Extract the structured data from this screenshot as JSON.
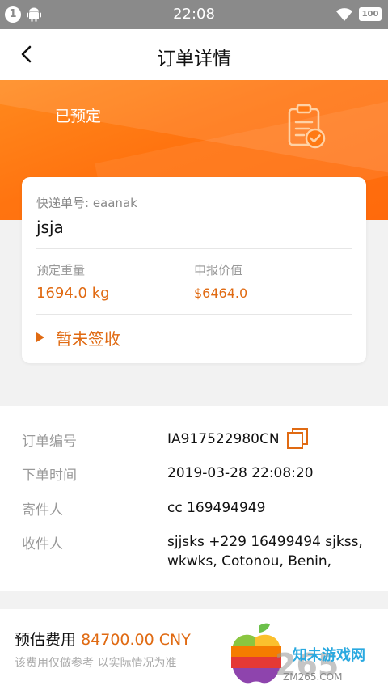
{
  "status_bar": {
    "notification_count": "1",
    "time": "22:08",
    "battery": "100"
  },
  "nav": {
    "title": "订单详情",
    "back_icon": "chevron-left-icon"
  },
  "order_status": {
    "text": "已预定",
    "icon": "clipboard-check-icon"
  },
  "shipment_card": {
    "tracking_label": "快递单号: eaanak",
    "carrier": "jsja",
    "weight_label": "预定重量",
    "weight_value": "1694.0 kg",
    "declared_value_label": "申报价值",
    "declared_value": "$6464.0",
    "sign_status": "暂未签收"
  },
  "details": {
    "order_no_label": "订单编号",
    "order_no": "IA917522980CN",
    "order_time_label": "下单时间",
    "order_time": "2019-03-28 22:08:20",
    "sender_label": "寄件人",
    "sender": "cc 169494949",
    "recipient_label": "收件人",
    "recipient_line1": "sjjsks +229 16499494 sjkss,",
    "recipient_line2": "wkwks, Cotonou, Benin,"
  },
  "fee": {
    "label": "预估费用",
    "amount": "84700.00 CNY",
    "note": "该费用仅做参考 以实际情况为准"
  },
  "watermark": {
    "text_cn": "知未游戏网",
    "number": "265",
    "domain": "ZM265.COM"
  },
  "colors": {
    "accent": "#e06a12",
    "header_orange": "#ff7410",
    "status_bar": "#8a8a8a"
  }
}
